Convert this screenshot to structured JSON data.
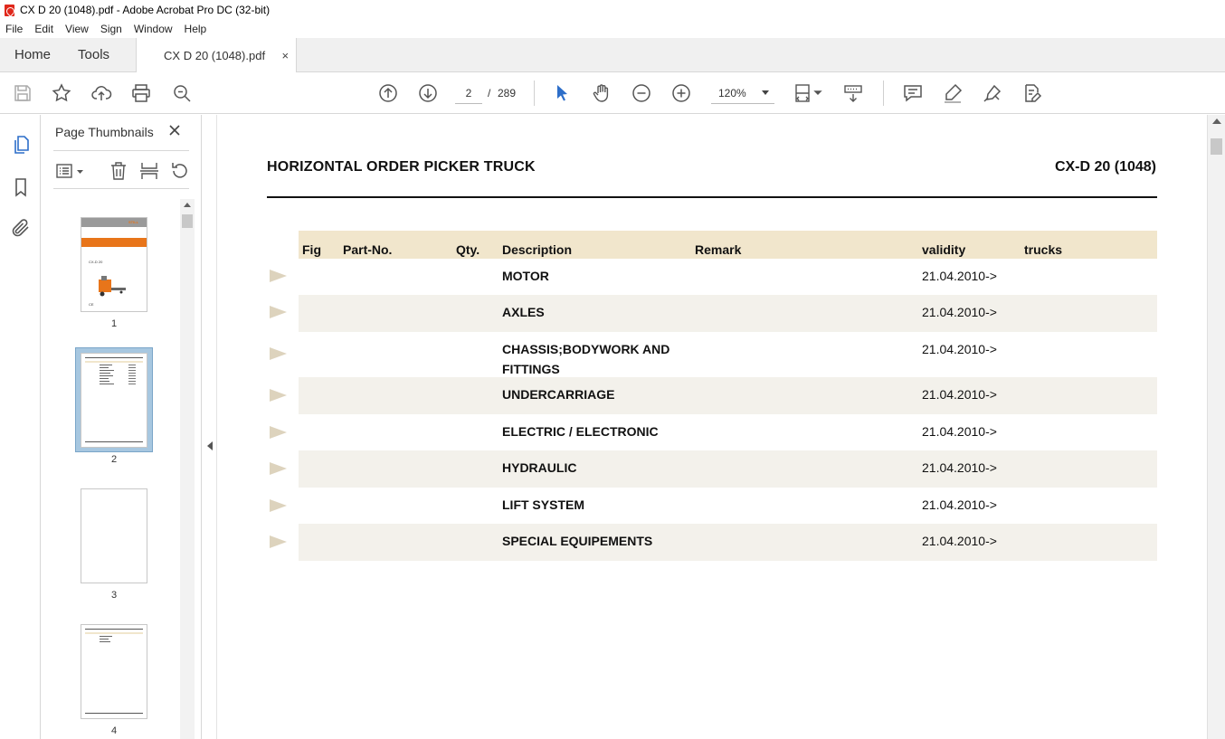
{
  "window": {
    "title": "CX D 20 (1048).pdf - Adobe Acrobat Pro DC (32-bit)"
  },
  "menu": [
    "File",
    "Edit",
    "View",
    "Sign",
    "Window",
    "Help"
  ],
  "tabs": {
    "home": "Home",
    "tools": "Tools",
    "document": "CX D 20 (1048).pdf",
    "close": "×"
  },
  "toolbar": {
    "page_current": "2",
    "page_sep": "/",
    "page_total": "289",
    "zoom": "120%"
  },
  "thumbnails": {
    "title": "Page Thumbnails",
    "pages": [
      {
        "num": "1",
        "logo": "STILL",
        "cover_text": "CX-D 20",
        "ce_mark": "CE"
      },
      {
        "num": "2"
      },
      {
        "num": "3"
      },
      {
        "num": "4"
      }
    ]
  },
  "colors": {
    "accent_blue": "#2d6ec9",
    "header_tan": "#f1e6cc",
    "row_shade": "#f3f1eb",
    "arrow_tan": "#ddd3bd",
    "cover_orange": "#e8751a"
  },
  "document": {
    "title": "HORIZONTAL ORDER PICKER TRUCK",
    "model": "CX-D 20 (1048)",
    "columns": {
      "fig": "Fig",
      "part_no": "Part-No.",
      "qty": "Qty.",
      "description": "Description",
      "remark": "Remark",
      "validity": "validity",
      "trucks": "trucks"
    },
    "rows": [
      {
        "description": "MOTOR",
        "validity": "21.04.2010->"
      },
      {
        "description": "AXLES",
        "validity": "21.04.2010->"
      },
      {
        "description": "CHASSIS;BODYWORK AND FITTINGS",
        "validity": "21.04.2010->"
      },
      {
        "description": "UNDERCARRIAGE",
        "validity": "21.04.2010->"
      },
      {
        "description": "ELECTRIC / ELECTRONIC",
        "validity": "21.04.2010->"
      },
      {
        "description": "HYDRAULIC",
        "validity": "21.04.2010->"
      },
      {
        "description": "LIFT SYSTEM",
        "validity": "21.04.2010->"
      },
      {
        "description": "SPECIAL EQUIPEMENTS",
        "validity": "21.04.2010->"
      }
    ]
  }
}
